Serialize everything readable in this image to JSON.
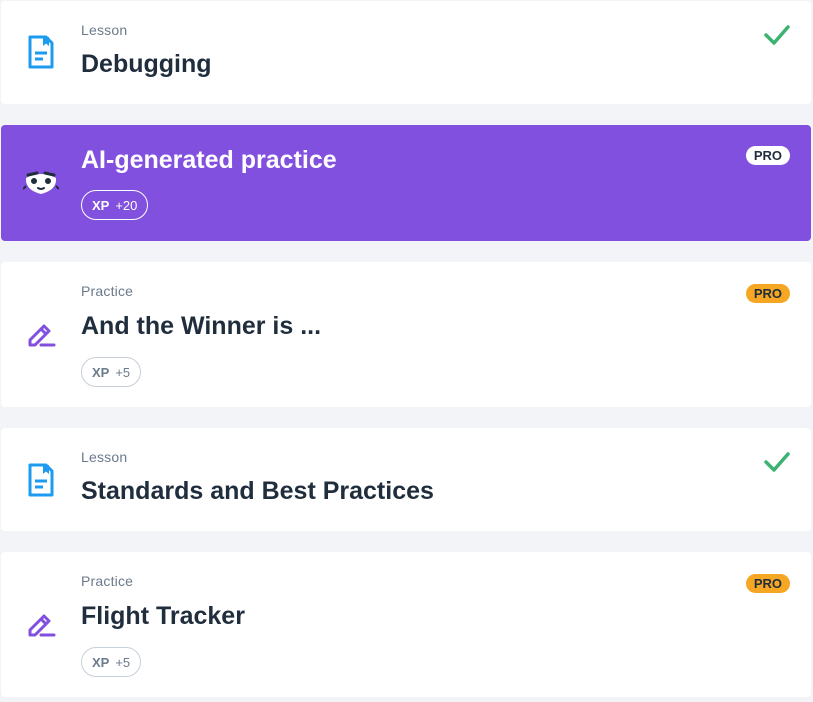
{
  "colors": {
    "accent_purple": "#8250df",
    "pro_orange": "#f5a623",
    "check_green": "#3cb371",
    "lesson_blue": "#1d9bf0"
  },
  "items": [
    {
      "kind": "Lesson",
      "title": "Debugging",
      "icon": "lesson-book-icon",
      "status": "completed"
    },
    {
      "kind": "",
      "title": "AI-generated practice",
      "icon": "ai-mascot-icon",
      "xp_label": "XP",
      "xp_value": "+20",
      "badge": "PRO"
    },
    {
      "kind": "Practice",
      "title": "And the Winner is ...",
      "icon": "pencil-practice-icon",
      "xp_label": "XP",
      "xp_value": "+5",
      "badge": "PRO"
    },
    {
      "kind": "Lesson",
      "title": "Standards and Best Practices",
      "icon": "lesson-book-icon",
      "status": "completed"
    },
    {
      "kind": "Practice",
      "title": "Flight Tracker",
      "icon": "pencil-practice-icon",
      "xp_label": "XP",
      "xp_value": "+5",
      "badge": "PRO"
    }
  ]
}
